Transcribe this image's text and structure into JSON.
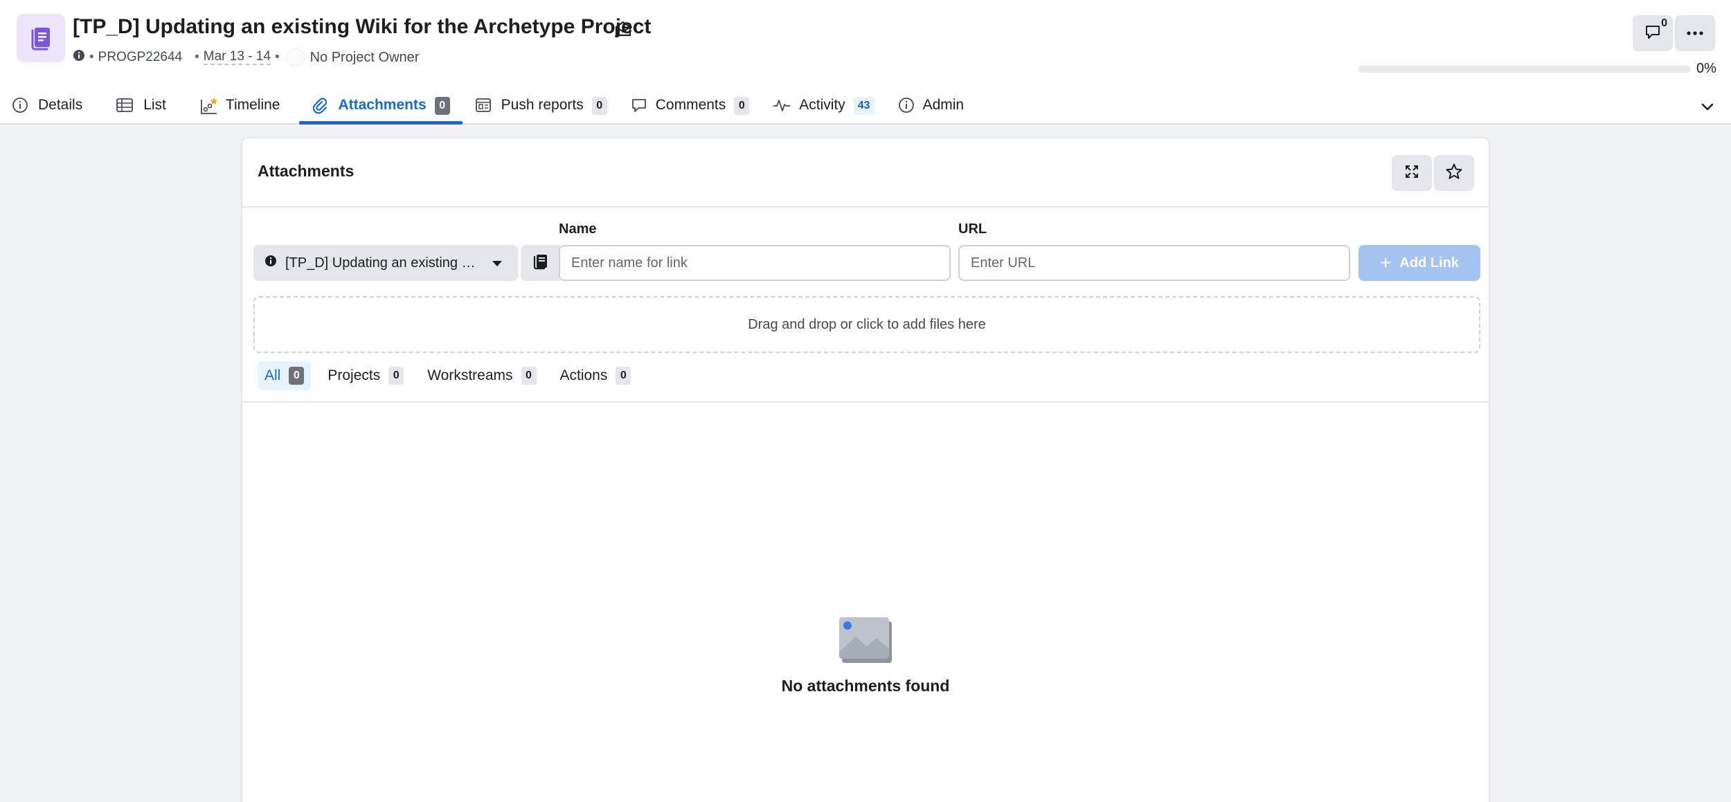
{
  "project": {
    "title": "[TP_D] Updating an existing Wiki for the Archetype Project",
    "code": "PROGP22644",
    "dates": "Mar 13 - 14",
    "owner": "No Project Owner",
    "progress_label": "0%",
    "progress_value": 0
  },
  "header": {
    "comments_count": "0"
  },
  "tabs": [
    {
      "label": "Details",
      "icon": "info-icon"
    },
    {
      "label": "List",
      "icon": "table-icon"
    },
    {
      "label": "Timeline",
      "icon": "timeline-icon"
    },
    {
      "label": "Attachments",
      "icon": "paperclip-icon",
      "count": "0",
      "active": true
    },
    {
      "label": "Push reports",
      "icon": "report-icon",
      "count": "0"
    },
    {
      "label": "Comments",
      "icon": "comment-icon",
      "count": "0"
    },
    {
      "label": "Activity",
      "icon": "activity-icon",
      "count": "43"
    },
    {
      "label": "Admin",
      "icon": "info-icon"
    }
  ],
  "card": {
    "title": "Attachments",
    "scope_select": "[TP_D] Updating an existing Wiki for the Archetype Project",
    "name_label": "Name",
    "name_placeholder": "Enter name for link",
    "url_label": "URL",
    "url_placeholder": "Enter URL",
    "add_link": "Add Link",
    "dropzone": "Drag and drop or click to add files here",
    "empty_text": "No attachments found"
  },
  "filters": [
    {
      "label": "All",
      "count": "0",
      "active": true
    },
    {
      "label": "Projects",
      "count": "0"
    },
    {
      "label": "Workstreams",
      "count": "0"
    },
    {
      "label": "Actions",
      "count": "0"
    }
  ],
  "colors": {
    "accent": "#1b6ac9",
    "app_icon_bg": "#ece5fb",
    "app_icon_fg": "#7b54e0",
    "add_link_disabled": "#a4c3f0"
  }
}
